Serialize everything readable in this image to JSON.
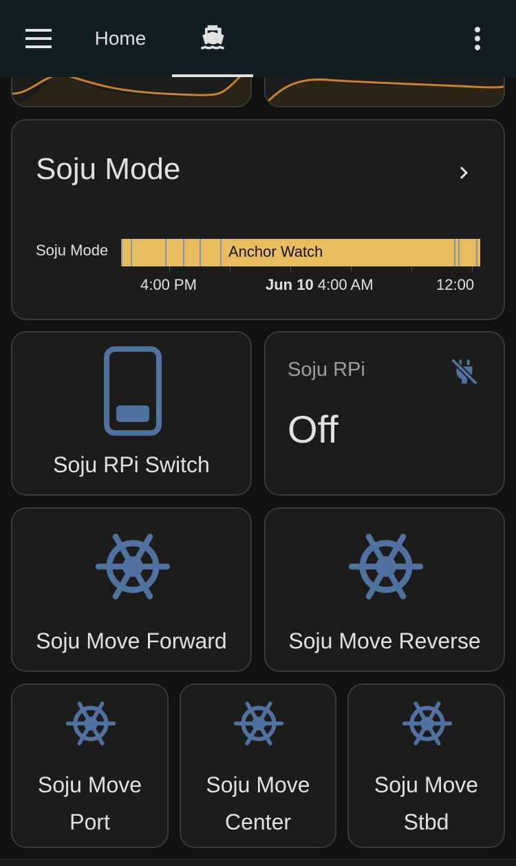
{
  "header": {
    "home_tab": "Home",
    "boat_tab_icon": "ferry-icon",
    "menu_icon": "hamburger-menu-icon",
    "more_icon": "dots-vertical-icon"
  },
  "mode_card": {
    "title": "Soju Mode",
    "row_label": "Soju Mode",
    "state": "Anchor Watch",
    "time_labels": {
      "t1": "4:00 PM",
      "date": "Jun 10",
      "t2": "4:00 AM",
      "t3": "12:00"
    },
    "colors": {
      "state_fill": "#e8bd5f",
      "change_marker": "#8a93a8"
    }
  },
  "switch_tile": {
    "name": "Soju RPi Switch",
    "icon": "cellphone-icon"
  },
  "entity_card": {
    "name": "Soju RPi",
    "state": "Off",
    "icon": "power-plug-off-icon"
  },
  "buttons": {
    "forward": "Soju Move Forward",
    "reverse": "Soju Move Reverse",
    "port_l1": "Soju Move",
    "port_l2": "Port",
    "center_l1": "Soju Move",
    "center_l2": "Center",
    "stbd_l1": "Soju Move",
    "stbd_l2": "Stbd"
  },
  "icon_color": "#4f729f"
}
